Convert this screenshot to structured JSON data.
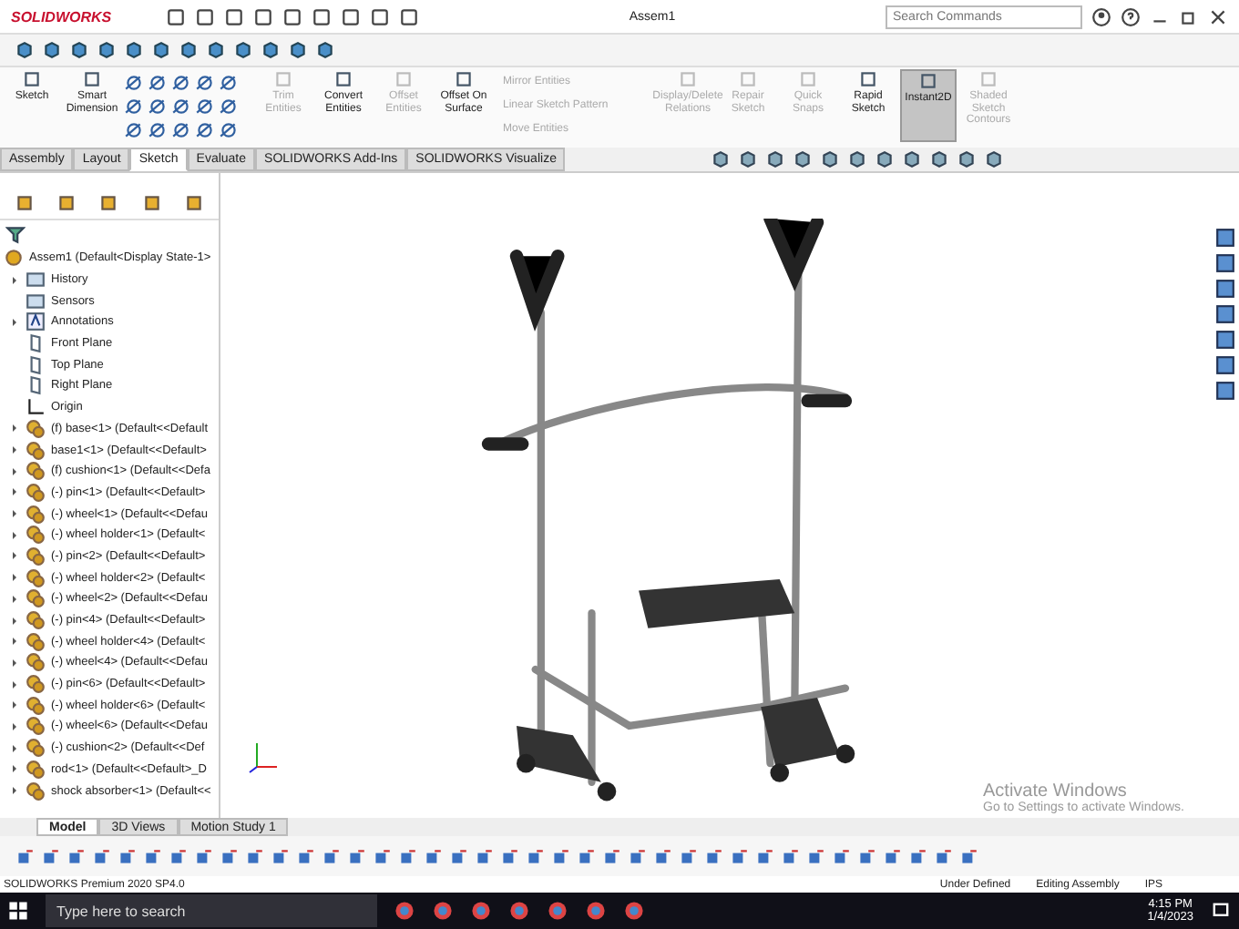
{
  "title_bar": {
    "logo": "SOLIDWORKS",
    "document": "Assem1",
    "search": {
      "placeholder": "Search Commands"
    }
  },
  "ribbon": {
    "sketch_commands": [
      {
        "label": "Sketch",
        "disabled": false
      },
      {
        "label": "Smart Dimension",
        "disabled": false
      }
    ],
    "entity_commands": [
      {
        "label": "Trim Entities",
        "disabled": true
      },
      {
        "label": "Convert Entities",
        "disabled": false
      },
      {
        "label": "Offset Entities",
        "disabled": true
      },
      {
        "label": "Offset On Surface",
        "disabled": false
      }
    ],
    "pattern_commands": [
      {
        "label": "Mirror Entities",
        "disabled": true
      },
      {
        "label": "Linear Sketch Pattern",
        "disabled": true
      },
      {
        "label": "Move Entities",
        "disabled": true
      }
    ],
    "tool_commands": [
      {
        "label": "Display/Delete Relations",
        "disabled": true,
        "pressed": false
      },
      {
        "label": "Repair Sketch",
        "disabled": true,
        "pressed": false
      },
      {
        "label": "Quick Snaps",
        "disabled": true,
        "pressed": false
      },
      {
        "label": "Rapid Sketch",
        "disabled": false,
        "pressed": false
      },
      {
        "label": "Instant2D",
        "disabled": false,
        "pressed": true
      },
      {
        "label": "Shaded Sketch Contours",
        "disabled": true,
        "pressed": false
      }
    ],
    "tabs": [
      {
        "label": "Assembly",
        "selected": false
      },
      {
        "label": "Layout",
        "selected": false
      },
      {
        "label": "Sketch",
        "selected": true
      },
      {
        "label": "Evaluate",
        "selected": false
      },
      {
        "label": "SOLIDWORKS Add-Ins",
        "selected": false
      },
      {
        "label": "SOLIDWORKS Visualize",
        "selected": false
      }
    ]
  },
  "feature_tree": {
    "root": {
      "label": "Assem1  (Default<Display State-1>",
      "children": [
        {
          "label": "History",
          "kind": "folder",
          "arrow": true
        },
        {
          "label": "Sensors",
          "kind": "folder",
          "arrow": false
        },
        {
          "label": "Annotations",
          "kind": "annotation",
          "arrow": true
        },
        {
          "label": "Front Plane",
          "kind": "plane",
          "arrow": false
        },
        {
          "label": "Top Plane",
          "kind": "plane",
          "arrow": false
        },
        {
          "label": "Right Plane",
          "kind": "plane",
          "arrow": false
        },
        {
          "label": "Origin",
          "kind": "origin",
          "arrow": false
        },
        {
          "label": "(f) base<1> (Default<<Default",
          "kind": "component",
          "arrow": true
        },
        {
          "label": "base1<1> (Default<<Default>",
          "kind": "component",
          "arrow": true
        },
        {
          "label": "(f) cushion<1> (Default<<Defa",
          "kind": "component",
          "arrow": true
        },
        {
          "label": "(-) pin<1> (Default<<Default>",
          "kind": "component",
          "arrow": true
        },
        {
          "label": "(-) wheel<1> (Default<<Defau",
          "kind": "component",
          "arrow": true
        },
        {
          "label": "(-) wheel holder<1> (Default<",
          "kind": "component",
          "arrow": true
        },
        {
          "label": "(-) pin<2> (Default<<Default>",
          "kind": "component",
          "arrow": true
        },
        {
          "label": "(-) wheel holder<2> (Default<",
          "kind": "component",
          "arrow": true
        },
        {
          "label": "(-) wheel<2> (Default<<Defau",
          "kind": "component",
          "arrow": true
        },
        {
          "label": "(-) pin<4> (Default<<Default>",
          "kind": "component",
          "arrow": true
        },
        {
          "label": "(-) wheel holder<4> (Default<",
          "kind": "component",
          "arrow": true
        },
        {
          "label": "(-) wheel<4> (Default<<Defau",
          "kind": "component",
          "arrow": true
        },
        {
          "label": "(-) pin<6> (Default<<Default>",
          "kind": "component",
          "arrow": true
        },
        {
          "label": "(-) wheel holder<6> (Default<",
          "kind": "component",
          "arrow": true
        },
        {
          "label": "(-) wheel<6> (Default<<Defau",
          "kind": "component",
          "arrow": true
        },
        {
          "label": "(-) cushion<2> (Default<<Def",
          "kind": "component",
          "arrow": true
        },
        {
          "label": "rod<1> (Default<<Default>_D",
          "kind": "component",
          "arrow": true
        },
        {
          "label": "shock absorber<1> (Default<<",
          "kind": "component",
          "arrow": true
        }
      ]
    }
  },
  "bottom_tabs": [
    {
      "label": "Model",
      "selected": true
    },
    {
      "label": "3D Views",
      "selected": false
    },
    {
      "label": "Motion Study 1",
      "selected": false
    }
  ],
  "activation_notice": {
    "title": "Activate Windows",
    "message": "Go to Settings to activate Windows."
  },
  "status_bar": {
    "product": "SOLIDWORKS Premium 2020 SP4.0",
    "sketch_state": "Under Defined",
    "mode": "Editing Assembly",
    "units": "IPS"
  },
  "taskbar": {
    "search": {
      "placeholder": "Type here to search"
    },
    "time": "4:15 PM",
    "date": "1/4/2023"
  }
}
